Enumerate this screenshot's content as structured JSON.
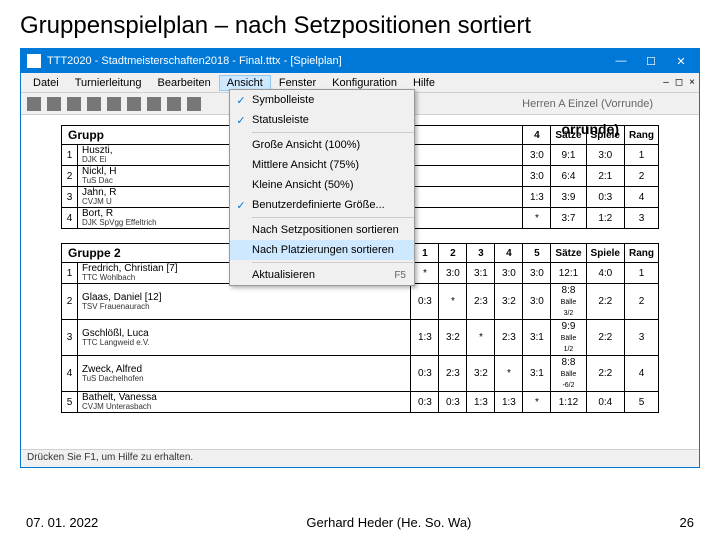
{
  "slide": {
    "title": "Gruppenspielplan – nach Setzpositionen sortiert"
  },
  "window": {
    "title": "TTT2020 - Stadtmeisterschaften2018 - Final.tttx - [Spielplan]"
  },
  "menu": {
    "items": [
      "Datei",
      "Turnierleitung",
      "Bearbeiten",
      "Ansicht",
      "Fenster",
      "Konfiguration",
      "Hilfe"
    ],
    "openIndex": 3
  },
  "toolbar": {
    "right_text": "Herren A Einzel (Vorrunde)"
  },
  "dropdown": {
    "items": [
      {
        "check": "✓",
        "label": "Symbolleiste",
        "sep": false
      },
      {
        "check": "✓",
        "label": "Statusleiste",
        "sep": true
      },
      {
        "check": "",
        "label": "Große Ansicht (100%)",
        "sep": false
      },
      {
        "check": "",
        "label": "Mittlere Ansicht (75%)",
        "sep": false
      },
      {
        "check": "",
        "label": "Kleine Ansicht (50%)",
        "sep": false
      },
      {
        "check": "✓",
        "label": "Benutzerdefinierte Größe...",
        "sep": true
      },
      {
        "check": "",
        "label": "Nach Setzpositionen sortieren",
        "sep": false
      },
      {
        "check": "",
        "label": "Nach Platzierungen sortieren",
        "highlight": true,
        "sep": true
      },
      {
        "check": "",
        "label": "Aktualisieren",
        "shortcut": "F5",
        "sep": false
      }
    ]
  },
  "heading_partial": "orrunde)",
  "group1": {
    "title": "Grupp",
    "cols": [
      "4",
      "Sätze",
      "Spiele",
      "Rang"
    ],
    "rows": [
      {
        "n": "1",
        "name": "Huszti,",
        "club": "DJK Ei",
        "c": [
          "3:0",
          "9:1",
          "3:0",
          "1"
        ]
      },
      {
        "n": "2",
        "name": "Nickl, H",
        "club": "TuS Dac",
        "c": [
          "3:0",
          "6:4",
          "2:1",
          "2"
        ]
      },
      {
        "n": "3",
        "name": "Jahn, R",
        "club": "CVJM U",
        "c": [
          "1:3",
          "3:9",
          "0:3",
          "4"
        ]
      },
      {
        "n": "4",
        "name": "Bort, R",
        "club": "DJK SpVgg Effeltrich",
        "c": [
          "*",
          "3:7",
          "1:2",
          "3"
        ]
      }
    ]
  },
  "group2": {
    "title": "Gruppe 2",
    "cols": [
      "1",
      "2",
      "3",
      "4",
      "5",
      "Sätze",
      "Spiele",
      "Rang"
    ],
    "rows": [
      {
        "n": "1",
        "name": "Fredrich, Christian [7]",
        "club": "TTC Wohlbach",
        "c": [
          "*",
          "3:0",
          "3:1",
          "3:0",
          "3:0",
          "12:1",
          "4:0",
          "1"
        ]
      },
      {
        "n": "2",
        "name": "Glaas, Daniel [12]",
        "club": "TSV Frauenaurach",
        "c": [
          "0:3",
          "*",
          "2:3",
          "3:2",
          "3:0",
          "8:8",
          "2:2",
          "2",
          "Bälle 3/2"
        ]
      },
      {
        "n": "3",
        "name": "Gschlößl, Luca",
        "club": "TTC Langweid e.V.",
        "c": [
          "1:3",
          "3:2",
          "*",
          "2:3",
          "3:1",
          "9:9",
          "2:2",
          "3",
          "Bälle 1/2"
        ]
      },
      {
        "n": "4",
        "name": "Zweck, Alfred",
        "club": "TuS Dachelhofen",
        "c": [
          "0:3",
          "2:3",
          "3:2",
          "*",
          "3:1",
          "8:8",
          "2:2",
          "4",
          "Bälle -6/2"
        ]
      },
      {
        "n": "5",
        "name": "Bathelt, Vanessa",
        "club": "CVJM Unterasbach",
        "c": [
          "0:3",
          "0:3",
          "1:3",
          "1:3",
          "*",
          "1:12",
          "0:4",
          "5"
        ]
      }
    ]
  },
  "statusbar": {
    "text": "Drücken Sie F1, um Hilfe zu erhalten."
  },
  "footer": {
    "date": "07. 01. 2022",
    "author": "Gerhard Heder (He. So. Wa)",
    "page": "26"
  }
}
